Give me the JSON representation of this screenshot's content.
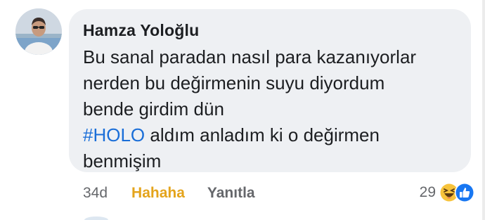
{
  "comment": {
    "author": "Hamza Yoloğlu",
    "lines": [
      "Bu sanal paradan nasıl para kazanıyorlar",
      "nerden bu değirmenin suyu diyordum",
      "bende girdim dün"
    ],
    "hashtag": "#HOLO",
    "hashtag_line_rest": " aldım anladım ki o değirmen",
    "last_line": "benmişim"
  },
  "actions": {
    "time": "34d",
    "reaction_label": "Hahaha",
    "reply_label": "Yanıtla"
  },
  "reactions": {
    "count": "29",
    "icons": [
      "haha-emoji-icon",
      "like-thumb-icon"
    ]
  },
  "colors": {
    "bubble": "#eef0f3",
    "hashtag": "#1a6ed8",
    "reaction_active": "#e4a41c",
    "meta": "#65676b"
  }
}
